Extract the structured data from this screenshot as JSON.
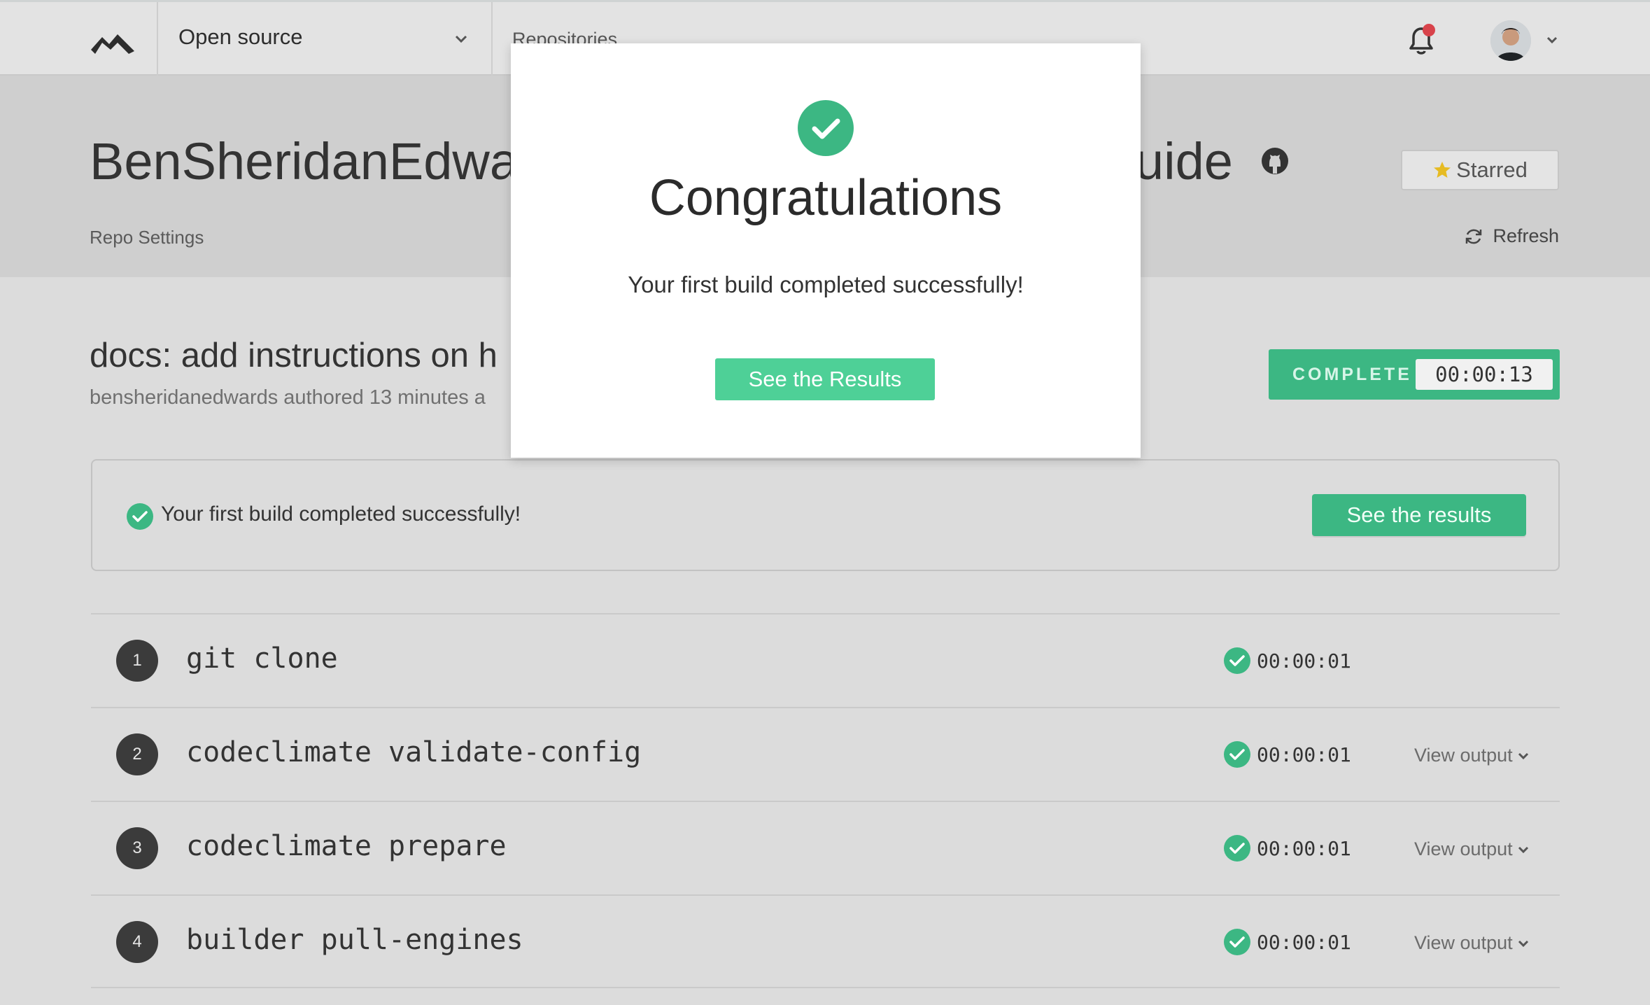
{
  "colors": {
    "accent_green": "#3cb783",
    "modal_button_green": "#4ed097",
    "notification_dot": "#d8434b",
    "star_yellow": "#e6bb23"
  },
  "nav": {
    "logo_icon": "codeclimate-logo-icon",
    "org_select": "Open source",
    "repos_link": "Repositories",
    "bell_icon": "bell-icon",
    "avatar_icon": "avatar"
  },
  "repo": {
    "title_left": "BenSheridanEdwar",
    "title_right": "uide",
    "github_icon": "github-icon",
    "star_label": "Starred",
    "settings_link": "Repo Settings",
    "refresh_label": "Refresh"
  },
  "commit": {
    "title": "docs: add instructions on h",
    "meta": "bensheridanedwards authored 13 minutes a",
    "status_label": "COMPLETE",
    "status_time": "00:00:13"
  },
  "banner": {
    "text": "Your first build completed successfully!",
    "button": "See the results"
  },
  "steps": [
    {
      "num": "1",
      "cmd": "git clone",
      "time": "00:00:01",
      "view": ""
    },
    {
      "num": "2",
      "cmd": "codeclimate validate-config",
      "time": "00:00:01",
      "view": "View output"
    },
    {
      "num": "3",
      "cmd": "codeclimate prepare",
      "time": "00:00:01",
      "view": "View output"
    },
    {
      "num": "4",
      "cmd": "builder pull-engines",
      "time": "00:00:01",
      "view": "View output"
    }
  ],
  "modal": {
    "title": "Congratulations",
    "text": "Your first build completed successfully!",
    "button": "See the Results"
  }
}
